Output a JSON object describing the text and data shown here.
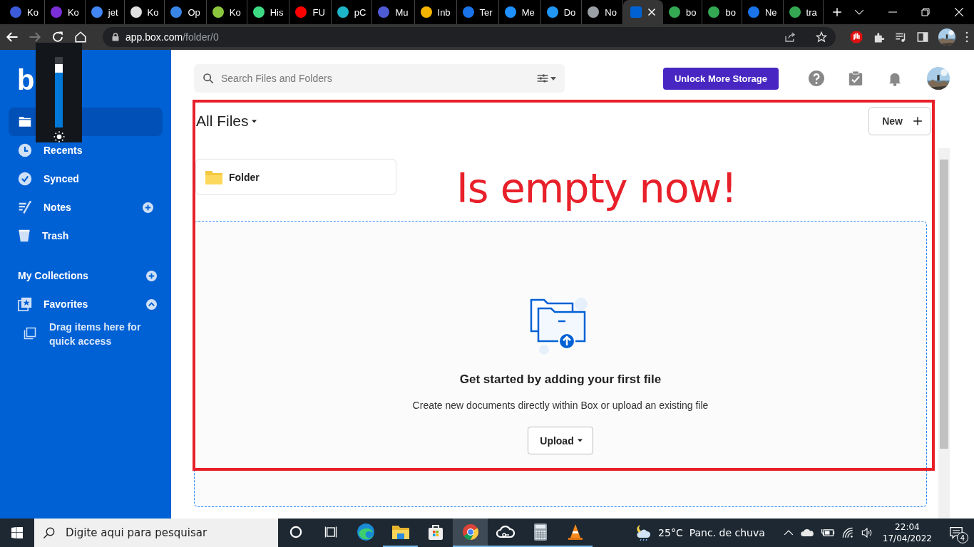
{
  "browser": {
    "tabs": [
      {
        "label": "Ko",
        "color": "#3b5bdb",
        "selected": false
      },
      {
        "label": "Ko",
        "color": "#7b2fd6",
        "selected": false
      },
      {
        "label": "jet",
        "color": "#4285f4",
        "selected": false
      },
      {
        "label": "Ko",
        "color": "#e0e0e0",
        "selected": false
      },
      {
        "label": "Op",
        "color": "#3a86e8",
        "selected": false
      },
      {
        "label": "Ko",
        "color": "#8cc63f",
        "selected": false
      },
      {
        "label": "His",
        "color": "#3ddc84",
        "selected": false
      },
      {
        "label": "FU",
        "color": "#ff0000",
        "selected": false
      },
      {
        "label": "pC",
        "color": "#1fb5c9",
        "selected": false
      },
      {
        "label": "Mu",
        "color": "#4f5bd5",
        "selected": false
      },
      {
        "label": "Inb",
        "color": "#f4b400",
        "selected": false
      },
      {
        "label": "Ter",
        "color": "#1a73e8",
        "selected": false
      },
      {
        "label": "Me",
        "color": "#1e90ff",
        "selected": false
      },
      {
        "label": "Do",
        "color": "#2196f3",
        "selected": false
      },
      {
        "label": "No",
        "color": "#9aa0a6",
        "selected": false
      },
      {
        "color": "#0061d5",
        "selected": true
      },
      {
        "label": "bo",
        "color": "#34a853",
        "selected": false
      },
      {
        "label": "bo",
        "color": "#34a853",
        "selected": false
      },
      {
        "label": "Ne",
        "color": "#1a73e8",
        "selected": false
      },
      {
        "label": "tra",
        "color": "#34a853",
        "selected": false
      }
    ],
    "forward_disabled": true,
    "address": {
      "host": "app.box.com",
      "path": "/folder/0"
    }
  },
  "brightness_overlay": {
    "level": 0.9
  },
  "sidebar": {
    "logo": "b",
    "nav": [
      {
        "kind": "plain",
        "selected": true
      },
      {
        "kind": "plain",
        "label": "Recents",
        "selected": false
      },
      {
        "kind": "plain",
        "label": "Synced",
        "selected": false
      },
      {
        "kind": "addable",
        "label": "Notes",
        "selected": false
      },
      {
        "kind": "plain",
        "label": "Trash",
        "selected": false
      }
    ],
    "collections": {
      "label": "My Collections"
    },
    "favorites": {
      "label": "Favorites",
      "expanded": true
    },
    "hint": "Drag items here for quick access"
  },
  "topbar": {
    "search": {
      "placeholder": "Search Files and Folders"
    },
    "upgrade_button": "Unlock More Storage"
  },
  "header": {
    "title": "All Files",
    "new_button": "New"
  },
  "folders": [
    {
      "name": "Folder"
    }
  ],
  "empty_state": {
    "heading": "Get started by adding your first file",
    "text": "Create new documents directly within Box or upload an existing file",
    "upload_button": "Upload"
  },
  "annotation": {
    "text": "Is empty now!"
  },
  "taskbar": {
    "search": {
      "placeholder": "Digite aqui para pesquisar"
    },
    "apps": [
      {
        "running": false,
        "selected": false
      },
      {
        "running": true,
        "selected": false
      },
      {
        "running": false,
        "selected": false
      },
      {
        "running": true,
        "selected": true
      },
      {
        "running": true,
        "selected": false
      },
      {
        "running": true,
        "selected": false
      },
      {
        "running": true,
        "selected": false
      }
    ],
    "weather": {
      "temperature": "25°C",
      "condition": "Panc. de chuva"
    },
    "time": "22:04",
    "date": "17/04/2022",
    "notifications": "4"
  }
}
